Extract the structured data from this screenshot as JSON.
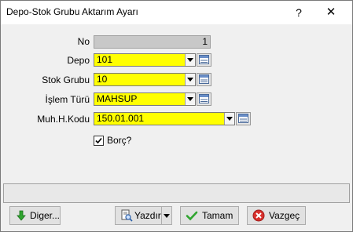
{
  "window": {
    "title": "Depo-Stok Grubu Aktarım Ayarı",
    "help_glyph": "?",
    "close_glyph": "✕"
  },
  "form": {
    "no": {
      "label": "No",
      "value": "1"
    },
    "depo": {
      "label": "Depo",
      "value": "101"
    },
    "stok_grubu": {
      "label": "Stok Grubu",
      "value": "10"
    },
    "islem_turu": {
      "label": "İşlem Türü",
      "value": "MAHSUP"
    },
    "muh_kodu": {
      "label": "Muh.H.Kodu",
      "value": "150.01.001"
    },
    "borc": {
      "label": "Borç?",
      "checked": true
    }
  },
  "colors": {
    "required_field": "#ffff00",
    "readonly_field": "#c8c8c8"
  },
  "buttons": {
    "diger": {
      "label": "Diger...",
      "icon": "arrow-down-icon"
    },
    "yazdir": {
      "label": "Yazdır",
      "icon": "print-preview-icon"
    },
    "tamam": {
      "label": "Tamam",
      "icon": "check-icon"
    },
    "vazgec": {
      "label": "Vazgeç",
      "icon": "cancel-icon"
    }
  }
}
